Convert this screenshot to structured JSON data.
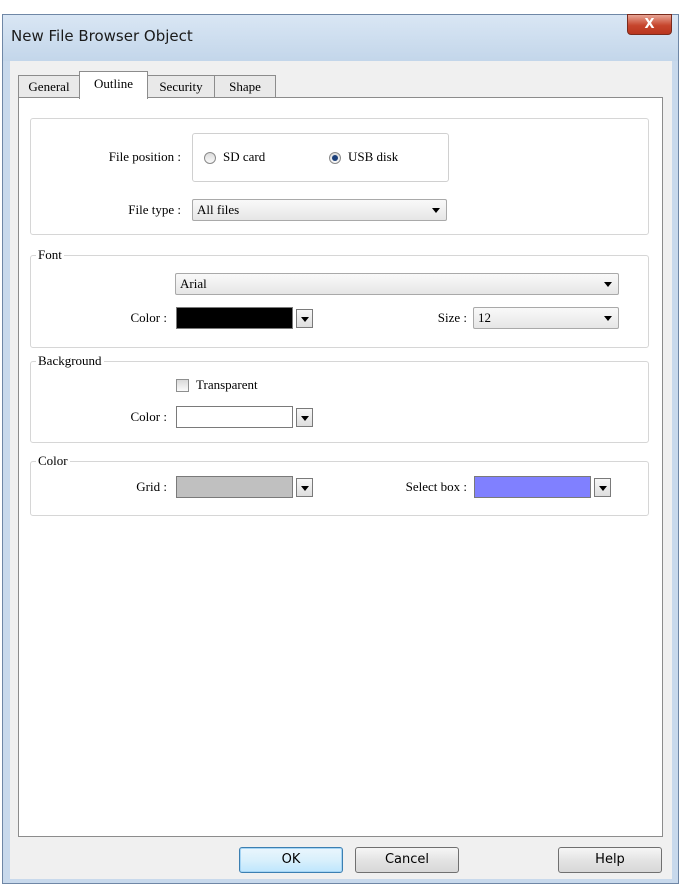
{
  "window": {
    "title": "New File Browser Object",
    "close_label": "X"
  },
  "tabs": [
    {
      "label": "General",
      "active": false
    },
    {
      "label": "Outline",
      "active": true
    },
    {
      "label": "Security",
      "active": false
    },
    {
      "label": "Shape",
      "active": false
    }
  ],
  "file_section": {
    "position_label": "File position :",
    "options": [
      {
        "label": "SD card",
        "selected": false
      },
      {
        "label": "USB disk",
        "selected": true
      }
    ],
    "type_label": "File type :",
    "type_value": "All files"
  },
  "font": {
    "legend": "Font",
    "name_value": "Arial",
    "color_label": "Color :",
    "color": "#000000",
    "size_label": "Size :",
    "size_value": "12"
  },
  "background": {
    "legend": "Background",
    "transparent_label": "Transparent",
    "transparent_checked": false,
    "color_label": "Color :",
    "color": "#ffffff"
  },
  "color_section": {
    "legend": "Color",
    "grid_label": "Grid :",
    "grid_color": "#c0c0c0",
    "select_label": "Select box :",
    "select_color": "#8080ff"
  },
  "buttons": {
    "ok": "OK",
    "cancel": "Cancel",
    "help": "Help"
  }
}
